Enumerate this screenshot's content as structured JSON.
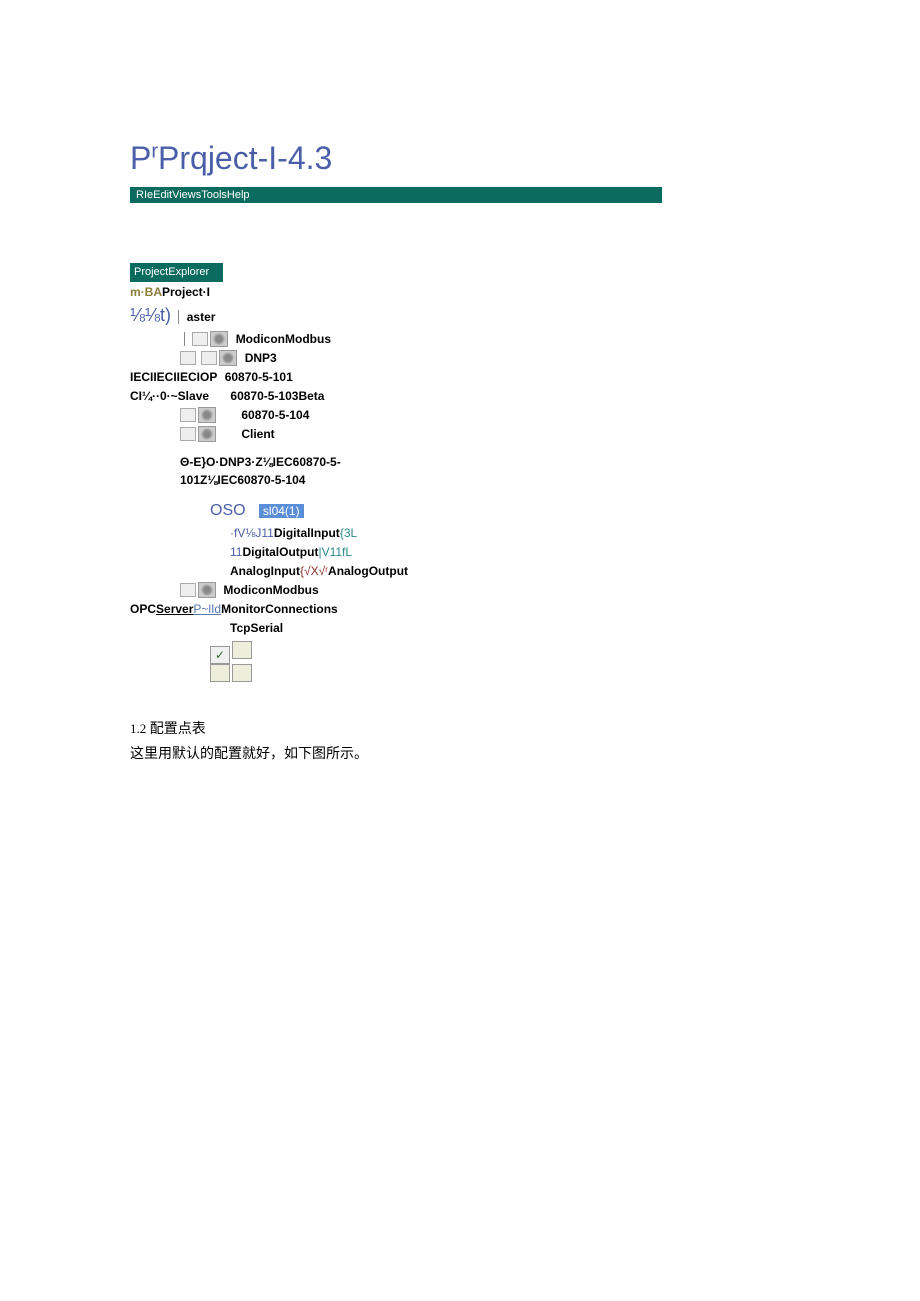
{
  "title_prefix": "P",
  "title_sup": "r",
  "title_main": "Prqject-I-4.3",
  "menubar": "RIeEditViewsToolsHelp",
  "explorer_header": "ProjectExplorer",
  "tree": {
    "root_prefix": "m·BA",
    "root_label": "Project·I",
    "frac_label": "⅛⅛t)",
    "aster": "aster",
    "modiconmodbus1": "ModiconModbus",
    "dnp3": "DNP3",
    "iec_line_left": "IECIIECIIECIOP",
    "iec_line_right": "60870-5-101",
    "ci_line_left": "CI¼··0·~Slave",
    "ci_line_right": "60870-5-103Beta",
    "line_104": "60870-5-104",
    "client": "Client",
    "middle_txt": "Θ-E}O·DNP3·Z⅛IEC60870-5-101Z⅛IEC60870-5-104",
    "oso": "OSO",
    "sl04": "sl04(1)",
    "digin_prefix": "·fV⅛J11",
    "digin": "DigitalInput",
    "digin_suffix": "{3L",
    "digout_prefix": "11",
    "digout": "DigitalOutput",
    "digout_suffix": "|V11fL",
    "anain": "AnalogInput",
    "anain_suffix": "{√X√ʳ",
    "anaout": "AnalogOutput",
    "modiconmodbus2": "ModiconModbus",
    "opc_prefix": "OPC",
    "server": "Server",
    "plld": "P~lId",
    "monitorcon": "MonitorConnections",
    "tcpserial": "TcpSerial"
  },
  "body": {
    "section_num": "1.2",
    "section_title": "配置点表",
    "section_text": "这里用默认的配置就好，如下图所示。"
  }
}
